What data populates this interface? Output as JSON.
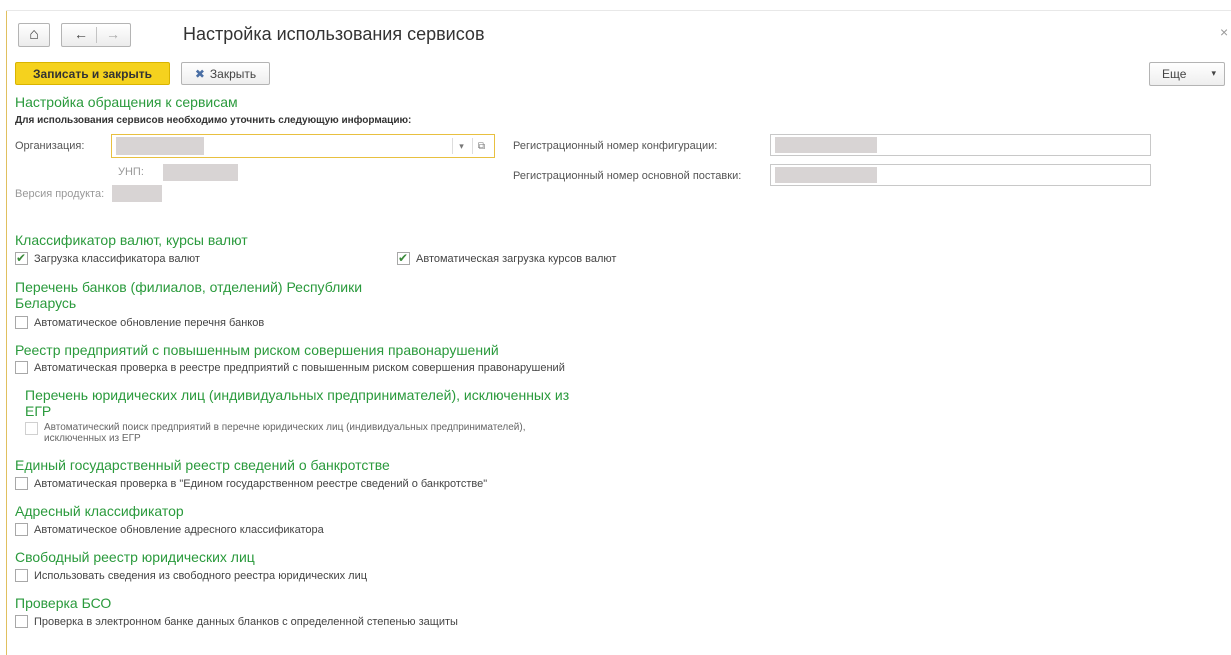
{
  "window": {
    "title": "Настройка использования сервисов",
    "close_glyph": "×"
  },
  "nav": {
    "home_icon": "⌂",
    "back_icon": "←",
    "forward_icon": "→"
  },
  "toolbar": {
    "save_close_label": "Записать и закрыть",
    "close_label": "Закрыть",
    "close_icon": "✖",
    "more_label": "Еще",
    "more_arrow": "▾"
  },
  "services": {
    "title": "Настройка обращения к сервисам",
    "hint": "Для использования сервисов необходимо уточнить следующую информацию:",
    "org_label": "Организация:",
    "unp_label": "УНП:",
    "version_label": "Версия продукта:",
    "reg_config_label": "Регистрационный номер конфигурации:",
    "reg_supply_label": "Регистрационный номер основной поставки:",
    "dropdown_icon": "▾",
    "open_icon": "⧉"
  },
  "currency": {
    "title": "Классификатор валют, курсы валют",
    "load_classifier_label": "Загрузка классификатора валют",
    "load_classifier_checked": true,
    "auto_rates_label": "Автоматическая загрузка курсов валют",
    "auto_rates_checked": true
  },
  "banks": {
    "title": "Перечень банков (филиалов, отделений) Республики Беларусь",
    "auto_update_label": "Автоматическое обновление перечня банков",
    "auto_update_checked": false
  },
  "risk_registry": {
    "title": "Реестр предприятий с повышенным риском совершения правонарушений",
    "auto_check_label": "Автоматическая проверка в реестре предприятий с повышенным риском совершения правонарушений",
    "auto_check_checked": false
  },
  "excluded": {
    "title": "Перечень юридических лиц (индивидуальных предпринимателей), исключенных из ЕГР",
    "auto_search_label": "Автоматический поиск предприятий в перечне юридических лиц (индивидуальных предпринимателей), исключенных из ЕГР",
    "auto_search_checked": false
  },
  "bankruptcy": {
    "title": "Единый государственный реестр сведений о банкротстве",
    "auto_check_label": "Автоматическая проверка в \"Едином государственном реестре сведений о банкротстве\"",
    "auto_check_checked": false
  },
  "address": {
    "title": "Адресный классификатор",
    "auto_update_label": "Автоматическое обновление адресного классификатора",
    "auto_update_checked": false
  },
  "free_registry": {
    "title": "Свободный реестр юридических лиц",
    "use_label": "Использовать сведения из свободного реестра юридических лиц",
    "use_checked": false
  },
  "bso": {
    "title": "Проверка БСО",
    "check_label": "Проверка в электронном банке данных бланков с определенной степенью защиты",
    "check_checked": false
  }
}
